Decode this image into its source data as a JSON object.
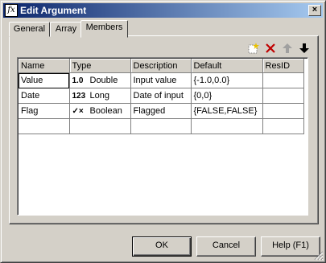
{
  "window": {
    "title": "Edit Argument",
    "icon": "fx-icon",
    "close_label": "×"
  },
  "tabs": [
    {
      "label": "General",
      "accel": "G"
    },
    {
      "label": "Array",
      "accel": "A"
    },
    {
      "label": "Members",
      "accel": "M",
      "active": true
    }
  ],
  "toolbar": [
    "new-row-icon",
    "delete-icon",
    "move-up-icon",
    "move-down-icon"
  ],
  "grid": {
    "headers": [
      "Name",
      "Type",
      "Description",
      "Default",
      "ResID"
    ],
    "rows": [
      {
        "name": "Value",
        "type_icon": "1.0",
        "type": "Double",
        "description": "Input value",
        "default": "{-1.0,0.0}",
        "resid": ""
      },
      {
        "name": "Date",
        "type_icon": "123",
        "type": "Long",
        "description": "Date of input",
        "default": "{0,0}",
        "resid": ""
      },
      {
        "name": "Flag",
        "type_icon": "✓×",
        "type": "Boolean",
        "description": "Flagged",
        "default": "{FALSE,FALSE}",
        "resid": ""
      }
    ]
  },
  "buttons": {
    "ok": "OK",
    "cancel": "Cancel",
    "help": "Help (F1)"
  }
}
